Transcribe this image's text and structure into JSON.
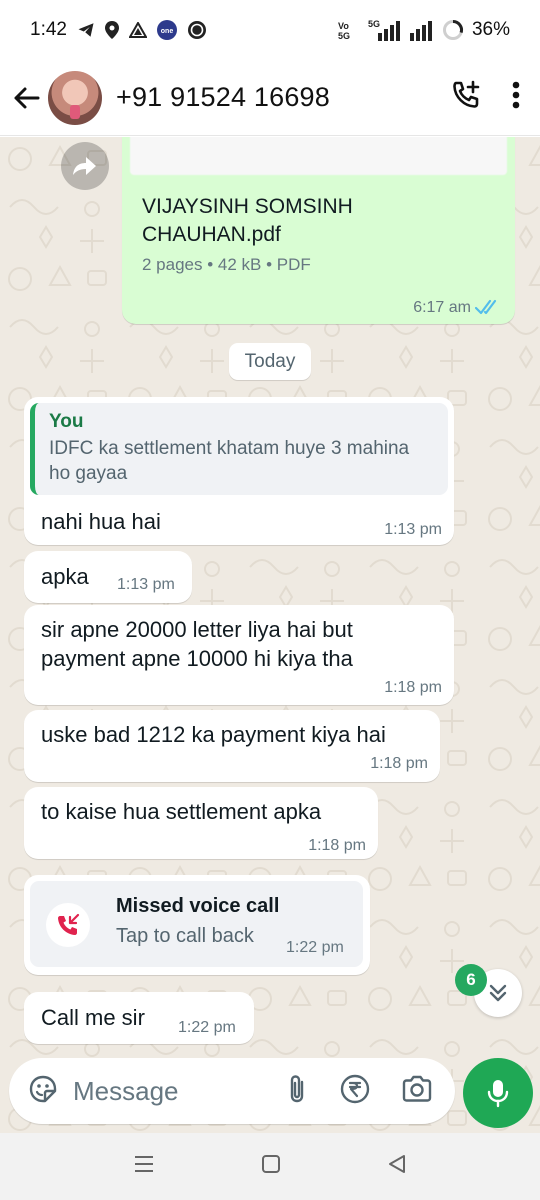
{
  "status_bar": {
    "time": "1:42",
    "battery": "36%",
    "network_badge": "5G",
    "volte": "Vo\nSG"
  },
  "header": {
    "contact_name": "+91 91524 16698"
  },
  "chat": {
    "document": {
      "file_name": "VIJAYSINH SOMSINH CHAUHAN.pdf",
      "meta": "2 pages • 42 kB • PDF",
      "time": "6:17 am",
      "status": "read"
    },
    "date_chip": "Today",
    "messages": [
      {
        "quote_author": "You",
        "quote_text": "IDFC ka settlement khatam huye 3 mahina ho gayaa",
        "text": "nahi hua hai",
        "time": "1:13 pm"
      },
      {
        "text": "apka",
        "time": "1:13 pm"
      },
      {
        "text": "sir apne 20000 letter liya hai but payment apne 10000 hi kiya tha",
        "time": "1:18 pm"
      },
      {
        "text": "uske bad 1212 ka payment kiya hai",
        "time": "1:18 pm"
      },
      {
        "text": "to kaise hua settlement apka",
        "time": "1:18 pm"
      },
      {
        "call_title": "Missed voice call",
        "call_sub": "Tap to call back",
        "time": "1:22 pm"
      },
      {
        "text": "Call me sir",
        "time": "1:22 pm"
      }
    ],
    "unread_count": "6"
  },
  "composer": {
    "placeholder": "Message"
  },
  "colors": {
    "accent": "#1fa855",
    "outgoing_bubble": "#d9fdd3",
    "chat_background": "#efeae2",
    "missed_call": "#e0234e",
    "read_ticks": "#53bdeb"
  },
  "icons": {
    "back": "arrow-left-icon",
    "add_call": "phone-plus-icon",
    "menu": "kebab-menu-icon",
    "forward": "forward-icon",
    "read_ticks": "double-check-icon",
    "missed_call": "missed-call-icon",
    "scroll_down": "chevrons-down-icon",
    "emoji": "sticker-icon",
    "attach": "paperclip-icon",
    "payment": "rupee-icon",
    "camera": "camera-icon",
    "mic": "microphone-icon",
    "nav_menu": "menu-lines-icon",
    "nav_home": "square-icon",
    "nav_back": "triangle-back-icon"
  }
}
